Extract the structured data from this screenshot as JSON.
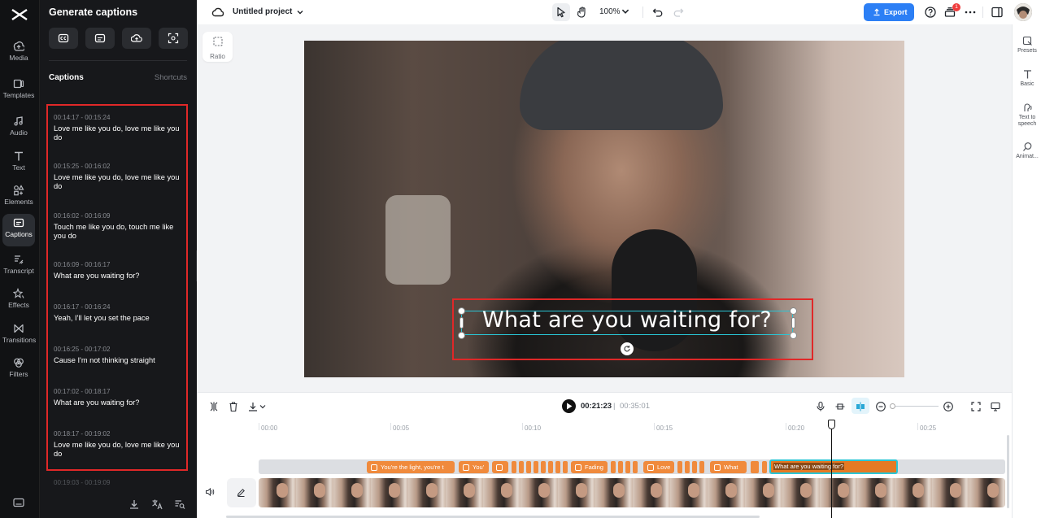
{
  "sidebar": {
    "items": [
      {
        "label": "Media",
        "icon": "media-icon"
      },
      {
        "label": "Templates",
        "icon": "templates-icon"
      },
      {
        "label": "Audio",
        "icon": "audio-icon"
      },
      {
        "label": "Text",
        "icon": "text-icon"
      },
      {
        "label": "Elements",
        "icon": "elements-icon"
      },
      {
        "label": "Captions",
        "icon": "captions-icon",
        "active": true
      },
      {
        "label": "Transcript",
        "icon": "transcript-icon"
      },
      {
        "label": "Effects",
        "icon": "effects-icon"
      },
      {
        "label": "Transitions",
        "icon": "transitions-icon"
      },
      {
        "label": "Filters",
        "icon": "filters-icon"
      }
    ]
  },
  "panel": {
    "title": "Generate captions",
    "captions_label": "Captions",
    "shortcuts_label": "Shortcuts",
    "captions": [
      {
        "time": "00:14:17 - 00:15:24",
        "text": "Love me like you do, love me like you do"
      },
      {
        "time": "00:15:25 - 00:16:02",
        "text": "Love me like you do, love me like you do"
      },
      {
        "time": "00:16:02 - 00:16:09",
        "text": "Touch me like you do, touch me like you do"
      },
      {
        "time": "00:16:09 - 00:16:17",
        "text": "What are you waiting for?"
      },
      {
        "time": "00:16:17 - 00:16:24",
        "text": "Yeah, I'll let you set the pace"
      },
      {
        "time": "00:16:25 - 00:17:02",
        "text": "Cause I'm not thinking straight"
      },
      {
        "time": "00:17:02 - 00:18:17",
        "text": "What are you waiting for?"
      },
      {
        "time": "00:18:17 - 00:19:02",
        "text": "Love me like you do, love me like you do"
      }
    ],
    "peek_time": "00:19:03 - 00:19:09"
  },
  "topbar": {
    "project_name": "Untitled project",
    "zoom": "100%",
    "export_label": "Export",
    "notification_count": "1"
  },
  "canvas": {
    "ratio_label": "Ratio",
    "caption_text": "What are you waiting for?"
  },
  "right_panel": {
    "items": [
      {
        "label": "Presets",
        "icon": "presets-icon"
      },
      {
        "label": "Basic",
        "icon": "basic-text-icon"
      },
      {
        "label": "Text to speech",
        "icon": "text-to-speech-icon"
      },
      {
        "label": "Animat...",
        "icon": "animation-icon"
      }
    ]
  },
  "timeline": {
    "current_time": "00:21:23",
    "separator": "|",
    "total_time": "00:35:01",
    "ticks": [
      "00:00",
      "00:05",
      "00:10",
      "00:15",
      "00:20",
      "00:25"
    ],
    "clips": [
      {
        "label": "You're the light, you're t"
      },
      {
        "label": "You'"
      },
      {
        "label": "Fading"
      },
      {
        "label": "Love"
      },
      {
        "label": "What"
      }
    ],
    "selected_clip": "What are you waiting for?"
  },
  "colors": {
    "accent": "#2c7ff5",
    "highlight": "#e02828",
    "clip": "#f08a3c",
    "selection": "#29c6d6"
  }
}
